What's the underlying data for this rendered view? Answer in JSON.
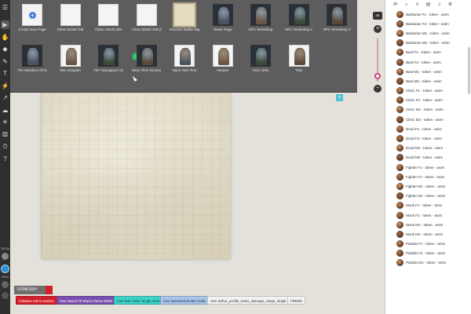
{
  "page_thumbnails": [
    {
      "label": "Create New Page",
      "kind": "new",
      "col": 0,
      "row": 0
    },
    {
      "label": "Clean 50x50 GM",
      "kind": "white",
      "col": 1,
      "row": 0
    },
    {
      "label": "Clean 30x30 GM",
      "kind": "white",
      "col": 2,
      "row": 0
    },
    {
      "label": "Clean 50x50 GM (Co",
      "kind": "white",
      "col": 3,
      "row": 0
    },
    {
      "label": "Random Battle Map",
      "kind": "parchment",
      "col": 4,
      "row": 0,
      "selected": true
    },
    {
      "label": "Tower Page",
      "kind": "dark",
      "col": 5,
      "row": 0
    },
    {
      "label": "NPC Workshop",
      "kind": "dark",
      "col": 6,
      "row": 0
    },
    {
      "label": "NPC Workshop 2",
      "kind": "dark",
      "col": 7,
      "row": 0
    },
    {
      "label": "NPC Workshop 3",
      "kind": "dark",
      "col": 8,
      "row": 0
    },
    {
      "label": "The Wardens Of Nor",
      "kind": "dark",
      "col": 0,
      "row": 1
    },
    {
      "label": "Ren Gaspien",
      "kind": "white-fig",
      "col": 1,
      "row": 1
    },
    {
      "label": "The Yawzgauch Clan",
      "kind": "dark",
      "col": 2,
      "row": 1
    },
    {
      "label": "Nano Tech Drones",
      "kind": "dark",
      "col": 3,
      "row": 1
    },
    {
      "label": "Nano Tech Tent",
      "kind": "white-fig",
      "col": 4,
      "row": 1
    },
    {
      "label": "Aksana",
      "kind": "white-fig",
      "col": 5,
      "row": 1
    },
    {
      "label": "Toxic Orbs",
      "kind": "dark",
      "col": 6,
      "row": 1
    },
    {
      "label": "Trab",
      "kind": "white-fig",
      "col": 7,
      "row": 1
    }
  ],
  "zoom": {
    "value": "44",
    "plus_label": "+",
    "minus_label": "−"
  },
  "close_label": "×",
  "toolbar": {
    "bottom_label": "JRGM",
    "bottom_label2": "NEW"
  },
  "macro_bar": {
    "label": "DONKUSH",
    "macros": [
      {
        "text": "Initiative-roll-to-tracker",
        "bg": "#d41f2a",
        "fg": "#ffffff"
      },
      {
        "text": "Gen Sword Of Black Flame Strike",
        "bg": "#7b4fb0",
        "fg": "#ffffff"
      },
      {
        "text": "Gen Bolt Celtic Single Shot",
        "bg": "#3ed3c8",
        "fg": "#114444"
      },
      {
        "text": "Gen Reload Bolt 900 Celtic",
        "bg": "#a9c4e8",
        "fg": "#223355"
      },
      {
        "text": "Gen arthur_profile_travis_damage_range_single",
        "bg": "#f2f2f2",
        "fg": "#333333"
      },
      {
        "text": "FREEE",
        "bg": "#f2f2f2",
        "fg": "#333333"
      }
    ]
  },
  "sidebar": {
    "tabs": [
      "chat-icon",
      "art-icon",
      "journal-icon",
      "compendium-icon",
      "jukebox-icon",
      "settings-icon"
    ],
    "tab_glyphs": [
      "✉",
      "⌂",
      "≡",
      "▤",
      "♫",
      "⚙"
    ],
    "characters": [
      "Barbarian F1 - token - anim",
      "Barbarian F2 - token - anim",
      "Barbarian M1 - token - anim",
      "Barbarian M2 - token - anim",
      "Bard F1 - token - anim",
      "Bard F2 - token - anim",
      "Bard M1 - token - anim",
      "Bard M2 - token - anim",
      "Cleric F1 - token - anim",
      "Cleric F2 - token - anim",
      "Cleric M1 - token - anim",
      "Cleric M2 - token - anim",
      "Druid F1 - token - anim",
      "Druid F2 - token - anim",
      "Druid M1 - token - anim",
      "Druid M2 - token - anim",
      "Fighter F1 - token - anim",
      "Fighter F2 - token - anim",
      "Fighter M1 - token - anim",
      "Fighter M2 - token - anim",
      "Monk F1 - token - anim",
      "Monk F2 - token - anim",
      "Monk M1 - token - anim",
      "Monk M2 - token - anim",
      "Paladin F1 - token - anim",
      "Paladin F2 - token - anim",
      "Paladin M1 - token - anim"
    ]
  },
  "tools": [
    {
      "name": "select-tool-icon",
      "glyph": "▶"
    },
    {
      "name": "pan-tool-icon",
      "glyph": "✋"
    },
    {
      "name": "layer-tool-icon",
      "glyph": "◆"
    },
    {
      "name": "draw-tool-icon",
      "glyph": "✎"
    },
    {
      "name": "text-tool-icon",
      "glyph": "T"
    },
    {
      "name": "fx-tool-icon",
      "glyph": "⚡"
    },
    {
      "name": "ruler-tool-icon",
      "glyph": "↗"
    },
    {
      "name": "fog-tool-icon",
      "glyph": "☁"
    },
    {
      "name": "lighting-tool-icon",
      "glyph": "☀"
    },
    {
      "name": "dice-tool-icon",
      "glyph": "⚄"
    },
    {
      "name": "turn-tracker-icon",
      "glyph": "⏱"
    },
    {
      "name": "help-icon",
      "glyph": "?"
    }
  ]
}
